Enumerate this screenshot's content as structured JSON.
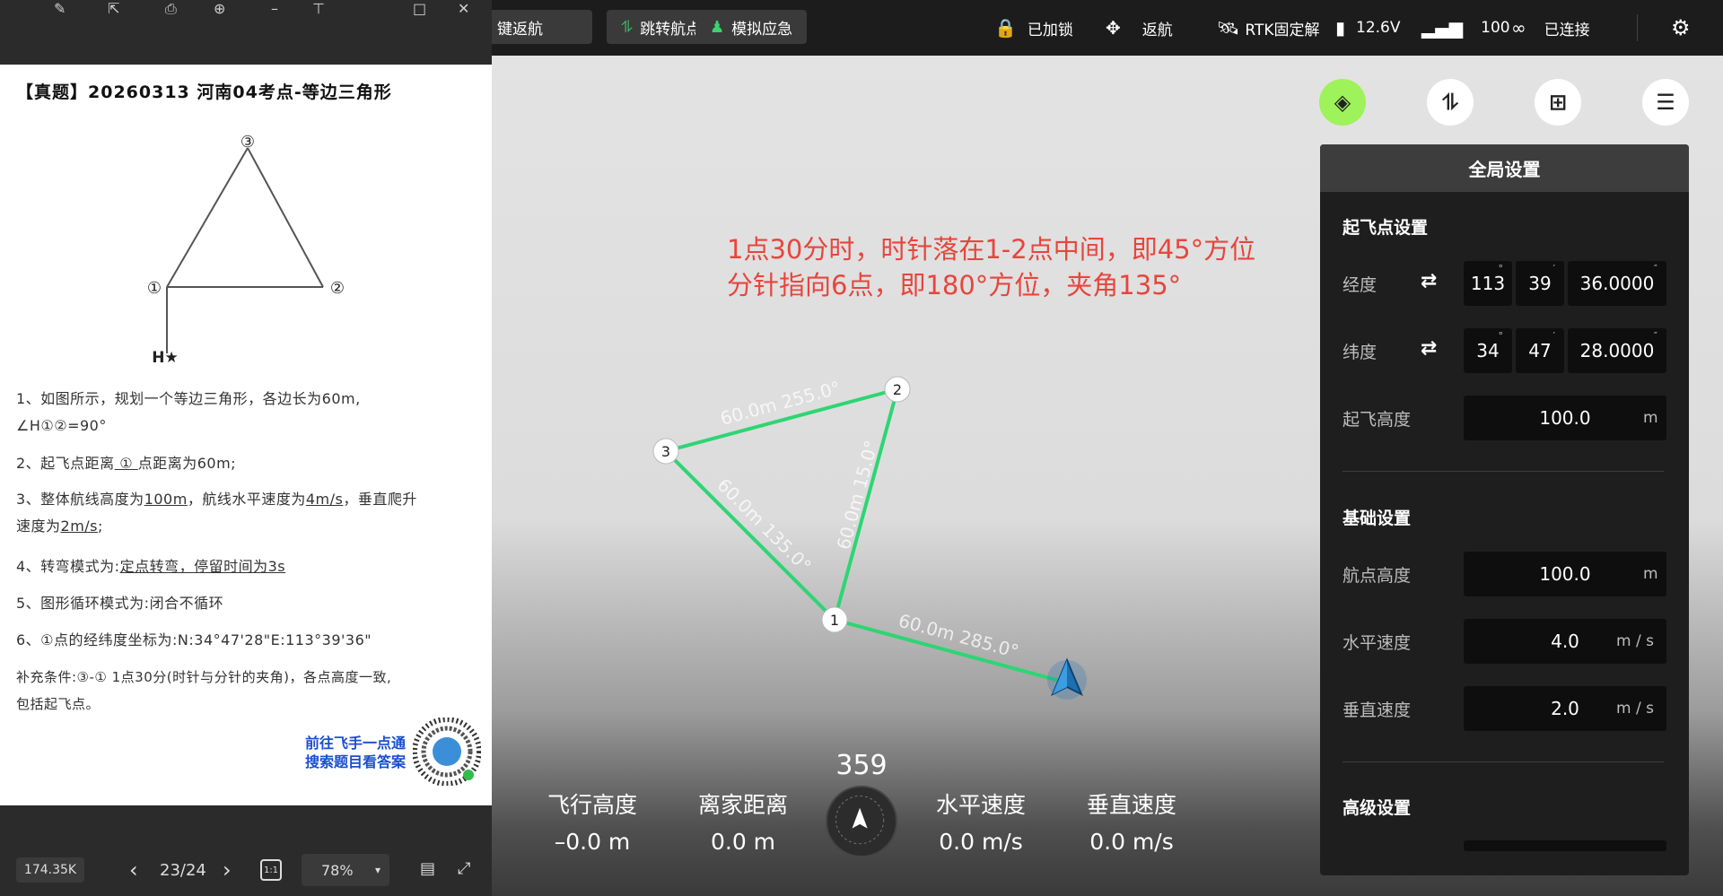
{
  "topbar": {
    "buttons": [
      "键返航",
      "跳转航点",
      "模拟应急"
    ],
    "status": {
      "lock": "已加锁",
      "rth": "返航",
      "rtk": "RTK固定解",
      "voltage": "12.6V",
      "signal": "100",
      "link": "已连接"
    }
  },
  "doc": {
    "title": "【真题】20260313 河南04考点-等边三角形",
    "figure": {
      "p1": "①",
      "p2": "②",
      "p3": "③",
      "home": "H★"
    },
    "req1a": "1、如图所示，规划一个等边三角形，各边长为60m,",
    "req1b": "∠H①②=90°",
    "req2a": "2、起飞点距离",
    "req2u": " ① ",
    "req2b": "点距离为60m;",
    "req3a": "3、整体航线高度为",
    "req3u1": "100m",
    "req3b": "，航线水平速度为",
    "req3u2": "4m/s",
    "req3c": "，垂直爬升",
    "req3d": "速度为",
    "req3u3": "2m/s",
    "req3e": ";",
    "req4a": "4、转弯模式为:",
    "req4u": "定点转弯，停留时间为3s",
    "req5": "5、图形循环模式为:闭合不循环",
    "req6": "6、①点的经纬度坐标为:N:34°47'28\"E:113°39'36\"",
    "req7a": "补充条件:③-① 1点30分(时针与分针的夹角)，各点高度一致,",
    "req7b": "包括起飞点。",
    "qr_line1": "前往飞手一点通",
    "qr_line2": "搜索题目看答案"
  },
  "viewer": {
    "file_size": "174.35K",
    "page": "23/24",
    "zoom": "78%",
    "ratio_btn": "1:1"
  },
  "map": {
    "annotation_line1": "1点30分时，时针落在1-2点中间，即45°方位",
    "annotation_line2": "分针指向6点，即180°方位，夹角135°",
    "waypoints": [
      "1",
      "2",
      "3"
    ],
    "segment_labels": {
      "s12": "60.0m 15.0°",
      "s23": "60.0m 255.0°",
      "s31": "60.0m 135.0°",
      "sh1": "60.0m 285.0°"
    },
    "route_color": "#2ed573"
  },
  "panel": {
    "title": "全局设置",
    "takeoff_section": "起飞点设置",
    "lon_label": "经度",
    "lon": {
      "deg": "113",
      "min": "39",
      "sec": "36.0000"
    },
    "lat_label": "纬度",
    "lat": {
      "deg": "34",
      "min": "47",
      "sec": "28.0000"
    },
    "alt_label": "起飞高度",
    "alt": "100.0",
    "alt_unit": "m",
    "basic_section": "基础设置",
    "wp_alt_label": "航点高度",
    "wp_alt": "100.0",
    "wp_alt_unit": "m",
    "hspeed_label": "水平速度",
    "hspeed": "4.0",
    "hspeed_unit": "m / s",
    "vspeed_label": "垂直速度",
    "vspeed": "2.0",
    "vspeed_unit": "m / s",
    "advanced_section": "高级设置"
  },
  "telemetry": {
    "alt_label": "飞行高度",
    "alt": "–0.0 m",
    "dist_label": "离家距离",
    "dist": "0.0 m",
    "heading": "359",
    "hspeed_label": "水平速度",
    "hspeed": "0.0 m/s",
    "vspeed_label": "垂直速度",
    "vspeed": "0.0 m/s"
  },
  "colors": {
    "accent": "#9ef25a",
    "annotation": "#e8453c",
    "route": "#2ed573"
  }
}
